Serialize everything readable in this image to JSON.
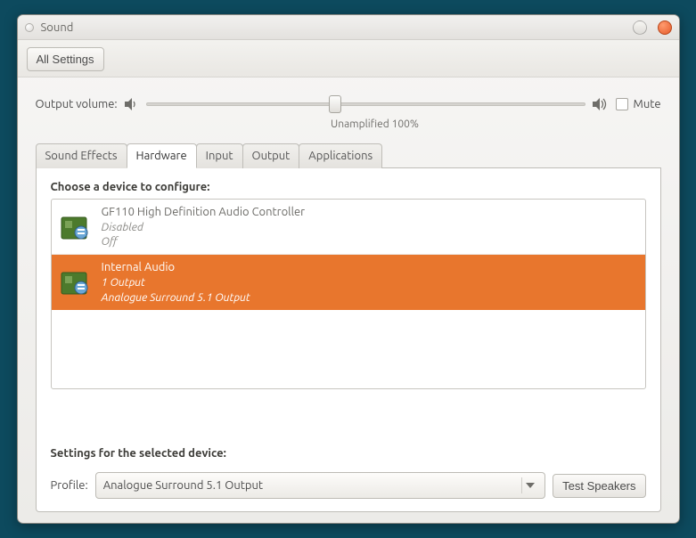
{
  "window": {
    "title": "Sound"
  },
  "toolbar": {
    "all_settings_label": "All Settings"
  },
  "volume": {
    "label": "Output volume:",
    "mute_label": "Mute",
    "caption": "Unamplified 100%"
  },
  "tabs": [
    {
      "id": "sound-effects",
      "label": "Sound Effects"
    },
    {
      "id": "hardware",
      "label": "Hardware"
    },
    {
      "id": "input",
      "label": "Input"
    },
    {
      "id": "output",
      "label": "Output"
    },
    {
      "id": "applications",
      "label": "Applications"
    }
  ],
  "active_tab": "hardware",
  "hardware": {
    "choose_heading": "Choose a device to configure:",
    "devices": [
      {
        "name": "GF110 High Definition Audio Controller",
        "status": "Disabled",
        "profile": "Off",
        "selected": false
      },
      {
        "name": "Internal Audio",
        "status": "1 Output",
        "profile": "Analogue Surround 5.1 Output",
        "selected": true
      }
    ],
    "settings_heading": "Settings for the selected device:",
    "profile_label": "Profile:",
    "profile_selected": "Analogue Surround 5.1 Output",
    "test_label": "Test Speakers"
  }
}
